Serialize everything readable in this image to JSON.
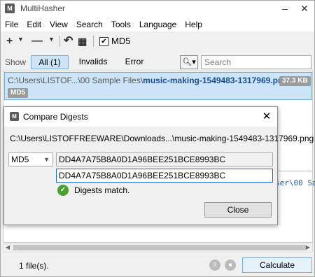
{
  "window": {
    "title": "MultiHasher",
    "app_icon": "M",
    "minimize": "–",
    "close": "✕"
  },
  "menu": [
    "File",
    "Edit",
    "View",
    "Search",
    "Tools",
    "Language",
    "Help"
  ],
  "toolbar": {
    "add_icon": "+",
    "remove_icon": "—",
    "undo_icon": "↶",
    "settings_icon": "▦",
    "md5_checked": "✔",
    "md5_label": "MD5"
  },
  "filter": {
    "show_label": "Show",
    "segments": [
      "All (1)",
      "Invalids",
      "Error"
    ],
    "search_icon": "🔍︎▾",
    "search_placeholder": "Search"
  },
  "files": [
    {
      "path": "C:\\Users\\LISTOF...\\00 Sample Files\\",
      "name": "music-making-1549483-1317969.png",
      "size": "37.3 KB",
      "algo": "MD5"
    }
  ],
  "background_path": "ser\\00 Sa",
  "status": {
    "count": "1 file(s).",
    "pause_icon": "II",
    "stop_icon": "■",
    "calculate": "Calculate"
  },
  "dialog": {
    "title": "Compare Digests",
    "icon": "M",
    "close": "✕",
    "path": "C:\\Users\\LISTOFFREEWARE\\Downloads...\\music-making-1549483-1317969.png",
    "algorithm": "MD5",
    "computed_digest": "DD4A7A75B8A0D1A96BEE251BCE8993BC",
    "entered_digest": "DD4A7A75B8A0D1A96BEE251BCE8993BC",
    "match_icon": "✓",
    "result": "Digests match.",
    "close_button": "Close"
  }
}
